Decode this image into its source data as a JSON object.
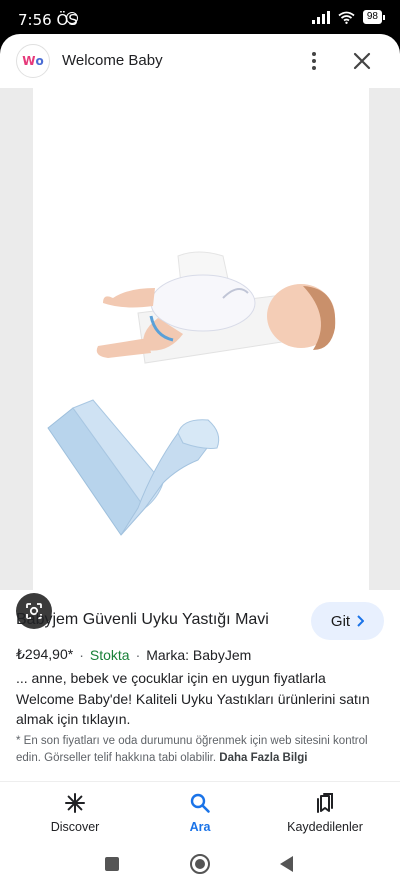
{
  "status_bar": {
    "time": "7:56 ÖS",
    "battery": "98"
  },
  "header": {
    "logo_w": "W",
    "logo_o": "o",
    "site_title": "Welcome Baby"
  },
  "product": {
    "title": "Babyjem Güvenli Uyku Yastığı Mavi",
    "go_label": "Git",
    "price": "₺294,90*",
    "stock": "Stokta",
    "brand": "Marka: BabyJem",
    "description": "... anne, bebek ve çocuklar için en uygun fiyatlarla Welcome Baby'de! Kaliteli Uyku Yastıkları ürünlerini satın almak için tıklayın.",
    "note": "* En son fiyatları ve oda durumunu öğrenmek için web sitesini kontrol edin. Görseller telif hakkına tabi olabilir.",
    "more_info": "Daha Fazla Bilgi"
  },
  "bottom_nav": [
    {
      "label": "Discover",
      "icon": "asterisk-icon"
    },
    {
      "label": "Ara",
      "icon": "search-icon",
      "active": true
    },
    {
      "label": "Kaydedilenler",
      "icon": "bookmarks-icon"
    }
  ],
  "colors": {
    "accent": "#1a73e8",
    "stock": "#188038",
    "go_button_bg": "#e8f0fe"
  }
}
